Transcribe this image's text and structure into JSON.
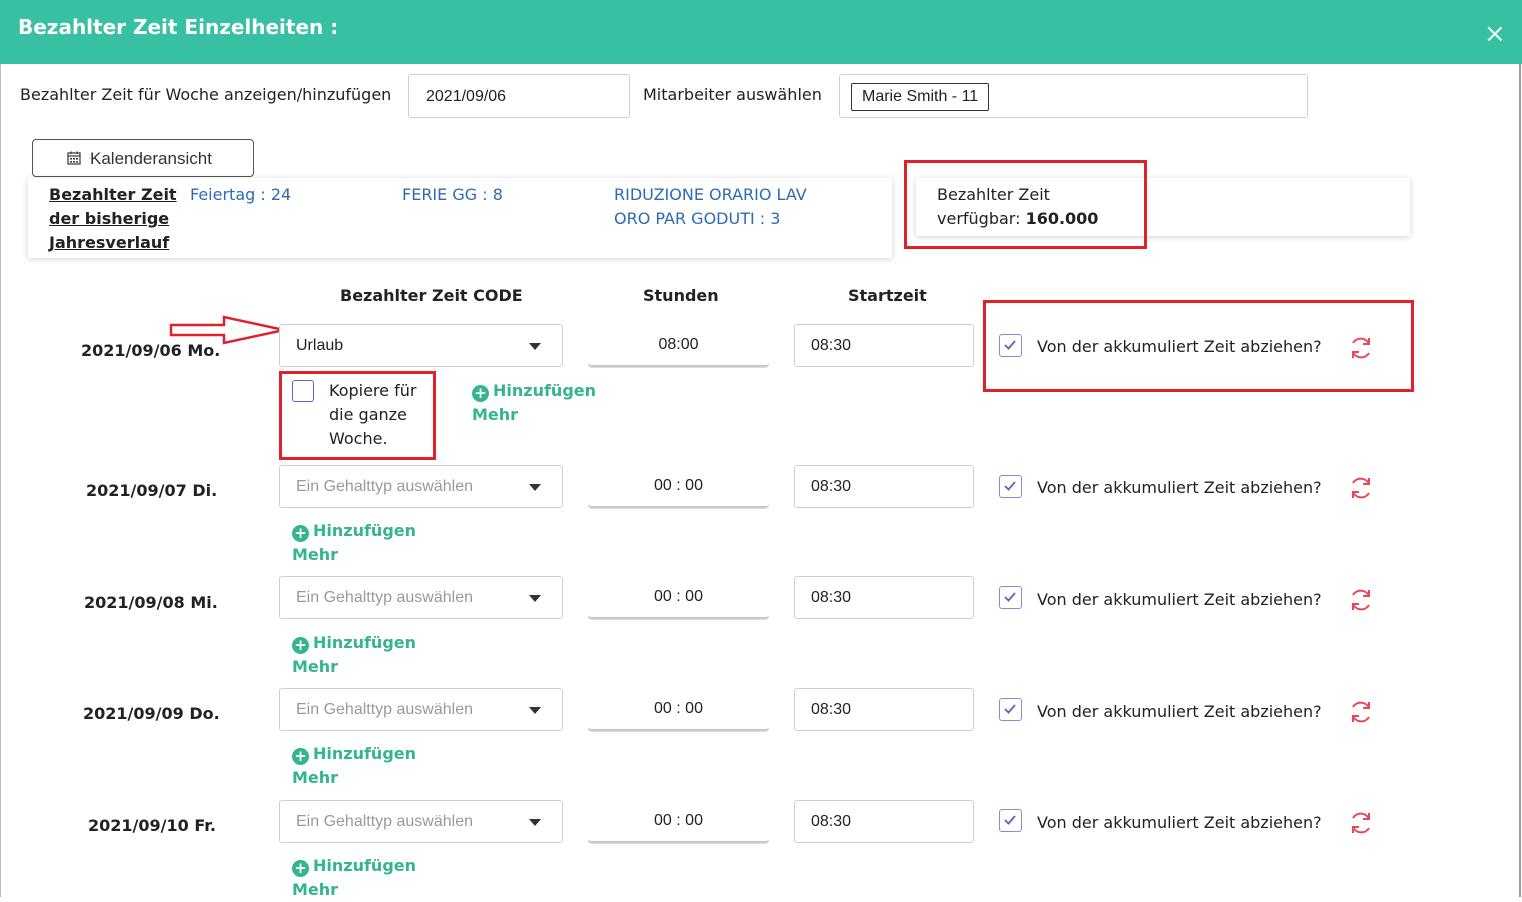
{
  "dialog": {
    "title": "Bezahlter Zeit Einzelheiten :",
    "close": "×"
  },
  "top": {
    "week_label": "Bezahlter Zeit für Woche anzeigen/hinzufügen",
    "week_value": "2021/09/06",
    "employee_label": "Mitarbeiter auswählen",
    "employee_value": "Marie Smith - 11"
  },
  "calendar_button": "Kalenderansicht",
  "history": {
    "title_lines": [
      "Bezahlter Zeit",
      "der bisherige",
      "Jahresverlauf"
    ],
    "stats": [
      {
        "text": "Feiertag : 24"
      },
      {
        "text": "FERIE GG : 8"
      },
      {
        "line1": "RIDUZIONE ORARIO LAV",
        "line2": "ORO PAR GODUTI : 3"
      }
    ]
  },
  "available": {
    "line1": "Bezahlter Zeit",
    "line2_prefix": "verfügbar:",
    "value": "160.000"
  },
  "columns": {
    "code": "Bezahlter Zeit CODE",
    "hours": "Stunden",
    "start": "Startzeit"
  },
  "rows": [
    {
      "date": "2021/09/06 Mo.",
      "code": "Urlaub",
      "hours": "08:00",
      "start": "08:30",
      "deduct": "Von der akkumuliert Zeit abziehen?",
      "checked": true
    },
    {
      "date": "2021/09/07 Di.",
      "code": "Ein Gehalttyp auswählen",
      "hours": "00 : 00",
      "start": "08:30",
      "deduct": "Von der akkumuliert Zeit abziehen?",
      "checked": true
    },
    {
      "date": "2021/09/08 Mi.",
      "code": "Ein Gehalttyp auswählen",
      "hours": "00 : 00",
      "start": "08:30",
      "deduct": "Von der akkumuliert Zeit abziehen?",
      "checked": true
    },
    {
      "date": "2021/09/09 Do.",
      "code": "Ein Gehalttyp auswählen",
      "hours": "00 : 00",
      "start": "08:30",
      "deduct": "Von der akkumuliert Zeit abziehen?",
      "checked": true
    },
    {
      "date": "2021/09/10 Fr.",
      "code": "Ein Gehalttyp auswählen",
      "hours": "00 : 00",
      "start": "08:30",
      "deduct": "Von der akkumuliert Zeit abziehen?",
      "checked": true
    }
  ],
  "copy_week": {
    "lines": [
      "Kopiere für",
      "die ganze",
      "Woche."
    ]
  },
  "add_more": {
    "line1": "Hinzufügen",
    "line2": "Mehr"
  },
  "colors": {
    "header": "#38c0a2",
    "accent": "#35b58f",
    "link": "#2d6bb3",
    "highlight": "#e0202a",
    "refresh": "#e8465a"
  }
}
